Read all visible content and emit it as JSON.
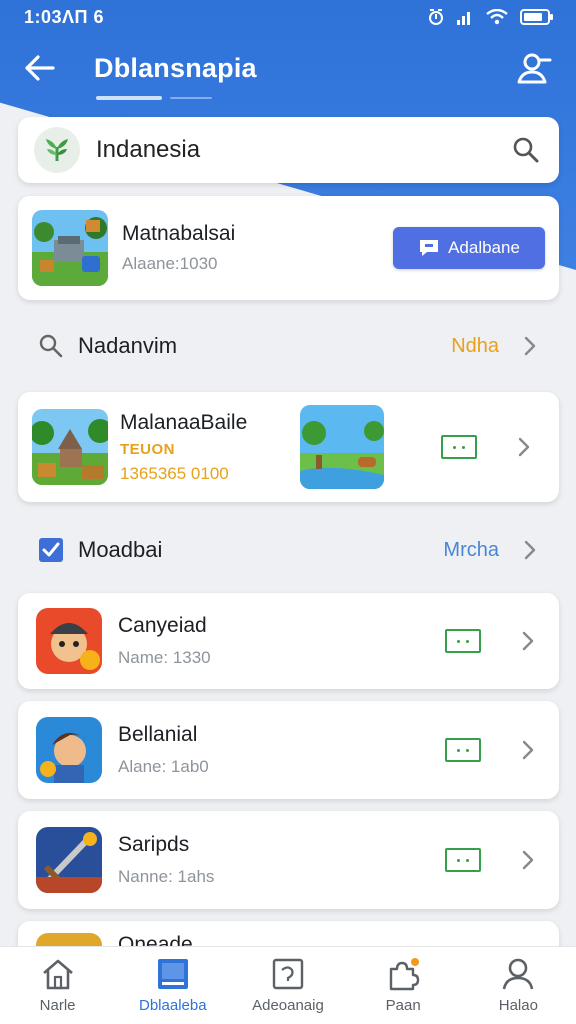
{
  "status": {
    "time": "1:03ΛΠ 6"
  },
  "app_bar": {
    "title": "Dblansnapia"
  },
  "search": {
    "value": "Indanesia"
  },
  "featured": {
    "title": "Matnabalsai",
    "subtitle": "Alaane:1030",
    "button_label": "Adalbane"
  },
  "section1": {
    "label": "Nadanvim",
    "more": "Ndha",
    "more_color": "#e8a11a"
  },
  "big_card": {
    "title": "MalanaaBaile",
    "tag": "TEUON",
    "stat": "1365365 0100"
  },
  "section2": {
    "label": "Moadbai",
    "more": "Mrcha",
    "more_color": "#4a86d6"
  },
  "list": [
    {
      "title": "Canyeiad",
      "subtitle": "Name: 1330"
    },
    {
      "title": "Bellanial",
      "subtitle": "Alane: 1ab0"
    },
    {
      "title": "Saripds",
      "subtitle": "Nanne: 1ahs"
    },
    {
      "title": "Oneade"
    }
  ],
  "bottom_nav": [
    {
      "label": "Narle",
      "icon": "home-icon",
      "active": false
    },
    {
      "label": "Dblaaleba",
      "icon": "book-icon",
      "active": true
    },
    {
      "label": "Adeoanaig",
      "icon": "gallery-icon",
      "active": false
    },
    {
      "label": "Paan",
      "icon": "puzzle-icon",
      "active": false
    },
    {
      "label": "Halao",
      "icon": "person-icon",
      "active": false
    }
  ],
  "colors": {
    "header_blue": "#2f72d8",
    "accent_button": "#4f6fe3",
    "green_icon": "#35a04a",
    "orange_text": "#e8a11a"
  }
}
